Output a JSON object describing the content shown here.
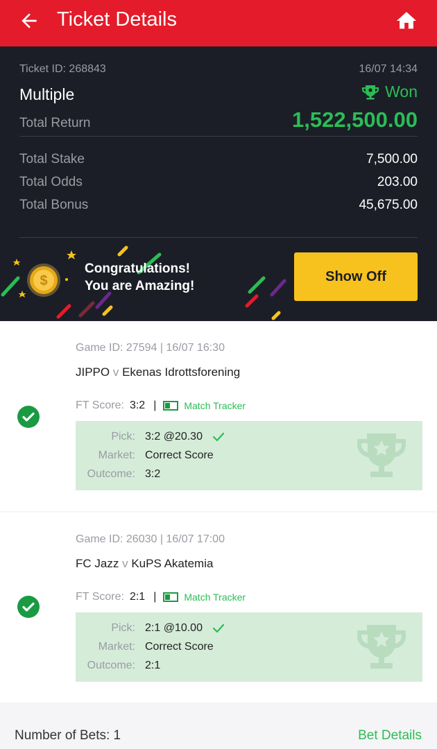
{
  "header": {
    "title": "Ticket Details",
    "back_icon": "arrow-left-icon",
    "home_icon": "home-icon"
  },
  "ticket": {
    "id_label": "Ticket ID: 268843",
    "datetime": "16/07 14:34",
    "type": "Multiple",
    "status": "Won",
    "total_return_label": "Total Return",
    "total_return": "1,522,500.00",
    "stats": [
      {
        "label": "Total Stake",
        "value": "7,500.00"
      },
      {
        "label": "Total Odds",
        "value": "203.00"
      },
      {
        "label": "Total Bonus",
        "value": "45,675.00"
      }
    ]
  },
  "banner": {
    "line1": "Congratulations!",
    "line2": "You are Amazing!",
    "button": "Show Off"
  },
  "bets": [
    {
      "game": "Game ID: 27594 | 16/07 16:30",
      "home": "JIPPO",
      "vs": "v",
      "away": "Ekenas Idrottsforening",
      "ft_label": "FT Score:",
      "ft_value": "3:2",
      "sep": "|",
      "tracker": "Match Tracker",
      "pick_label": "Pick:",
      "pick_value": "3:2 @20.30",
      "market_label": "Market:",
      "market_value": "Correct Score",
      "outcome_label": "Outcome:",
      "outcome_value": "3:2"
    },
    {
      "game": "Game ID: 26030 | 16/07 17:00",
      "home": "FC Jazz",
      "vs": "v",
      "away": "KuPS Akatemia",
      "ft_label": "FT Score:",
      "ft_value": "2:1",
      "sep": "|",
      "tracker": "Match Tracker",
      "pick_label": "Pick:",
      "pick_value": "2:1 @10.00",
      "market_label": "Market:",
      "market_value": "Correct Score",
      "outcome_label": "Outcome:",
      "outcome_value": "2:1"
    }
  ],
  "footer": {
    "num_bets": "Number of Bets: 1",
    "bet_details": "Bet Details"
  },
  "colors": {
    "header": "#e41b2a",
    "dark": "#1b1e27",
    "green": "#2bbd55",
    "button": "#f8c21e",
    "pick_bg": "#d5ecd9"
  }
}
